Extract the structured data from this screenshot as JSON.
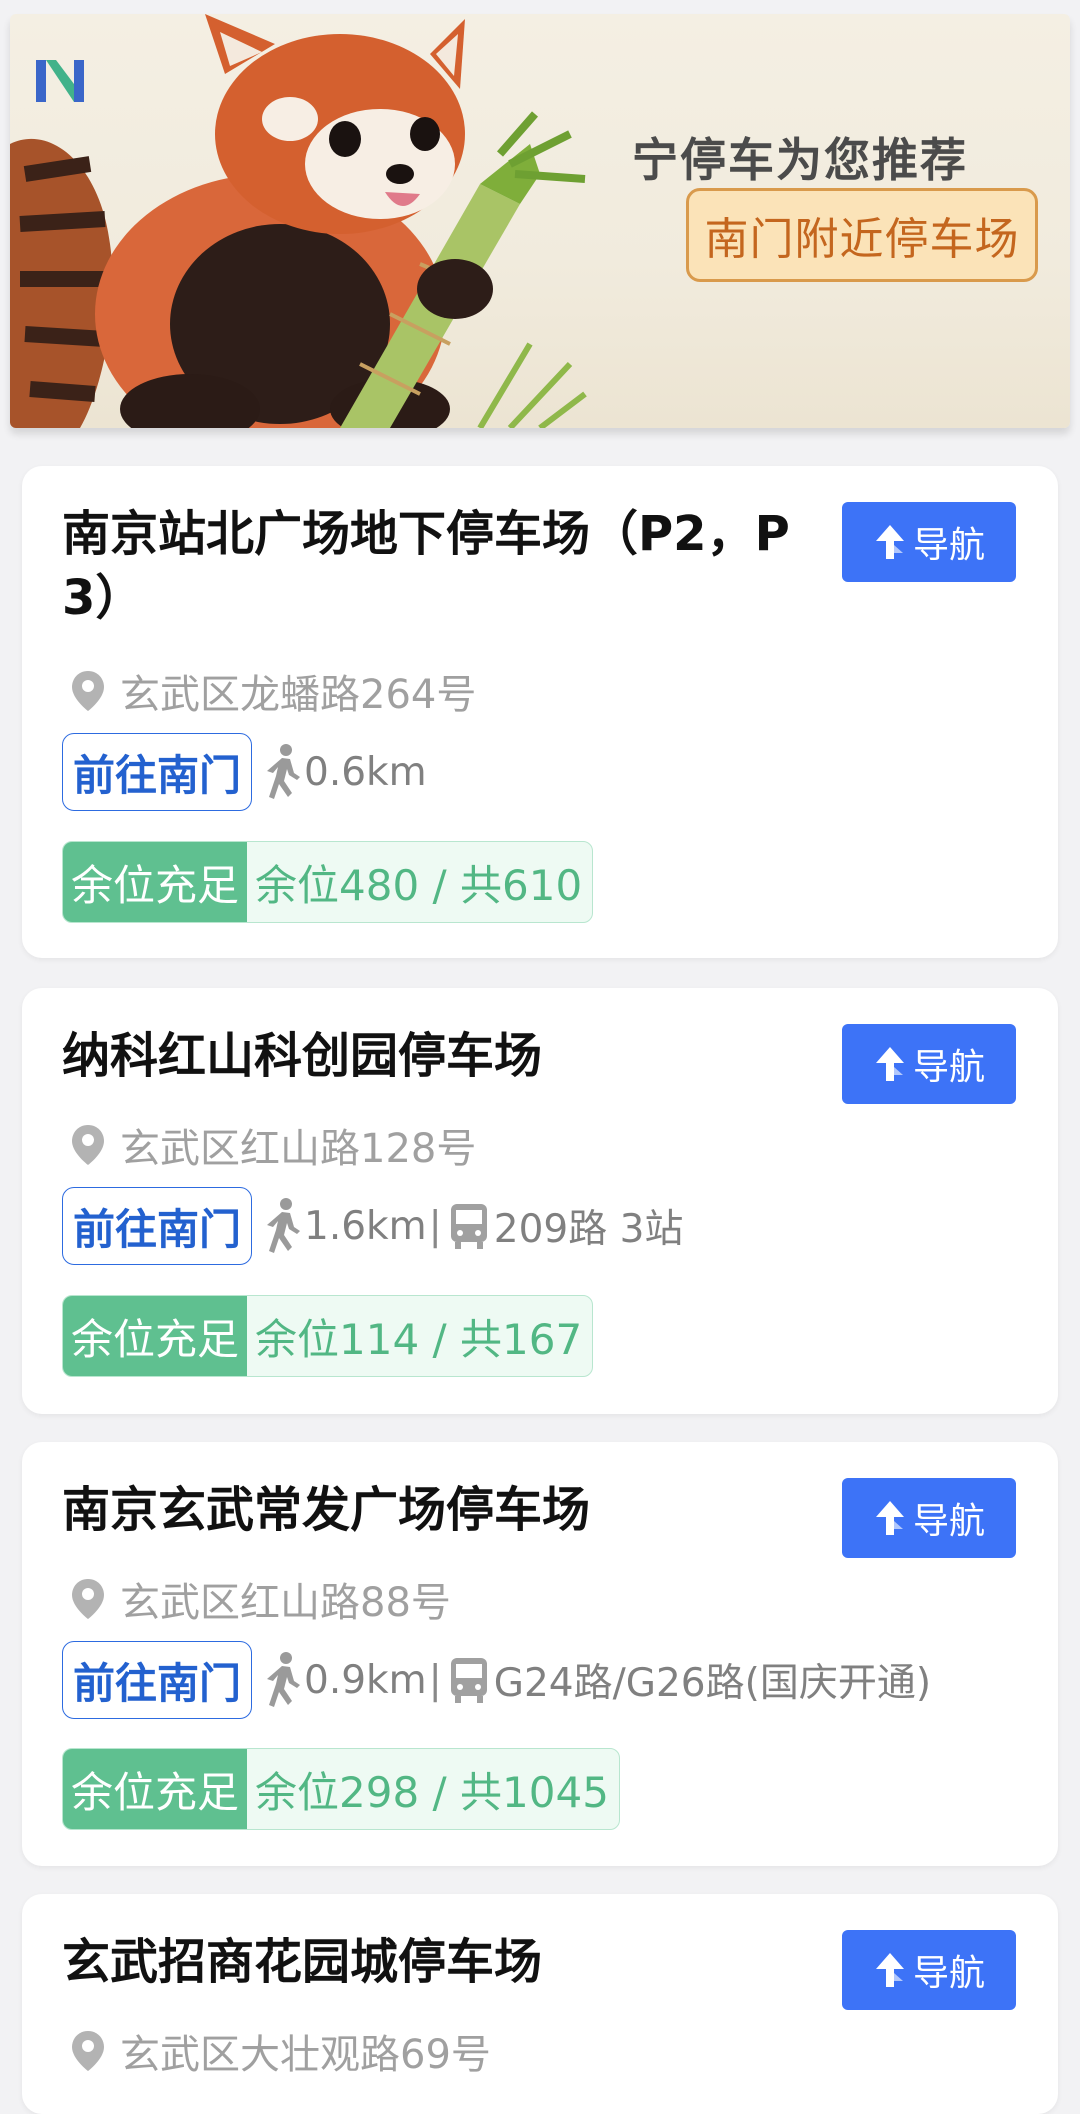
{
  "banner": {
    "title": "宁停车为您推荐",
    "badge": "南门附近停车场"
  },
  "lots": [
    {
      "name": "南京站北广场地下停车场（P2，P3）",
      "address": "玄武区龙蟠路264号",
      "gate_label": "前往南门",
      "walk_distance": "0.6km",
      "transit": "",
      "status": "余位充足",
      "spaces": "余位480 / 共610",
      "nav_label": "导航"
    },
    {
      "name": "纳科红山科创园停车场",
      "address": "玄武区红山路128号",
      "gate_label": "前往南门",
      "walk_distance": "1.6km",
      "transit": "209路 3站",
      "status": "余位充足",
      "spaces": "余位114 / 共167",
      "nav_label": "导航"
    },
    {
      "name": "南京玄武常发广场停车场",
      "address": "玄武区红山路88号",
      "gate_label": "前往南门",
      "walk_distance": "0.9km",
      "transit": "G24路/G26路(国庆开通)",
      "status": "余位充足",
      "spaces": "余位298 / 共1045",
      "nav_label": "导航"
    },
    {
      "name": "玄武招商花园城停车场",
      "address": "玄武区大壮观路69号",
      "nav_label": "导航"
    }
  ],
  "colors": {
    "nav_button": "#3d73f7",
    "status_green": "#5fc090",
    "gate_blue": "#2361cf",
    "badge_orange": "#c4661e"
  },
  "icons": [
    "location-pin-icon",
    "walk-icon",
    "bus-icon",
    "navigate-arrow-icon"
  ]
}
